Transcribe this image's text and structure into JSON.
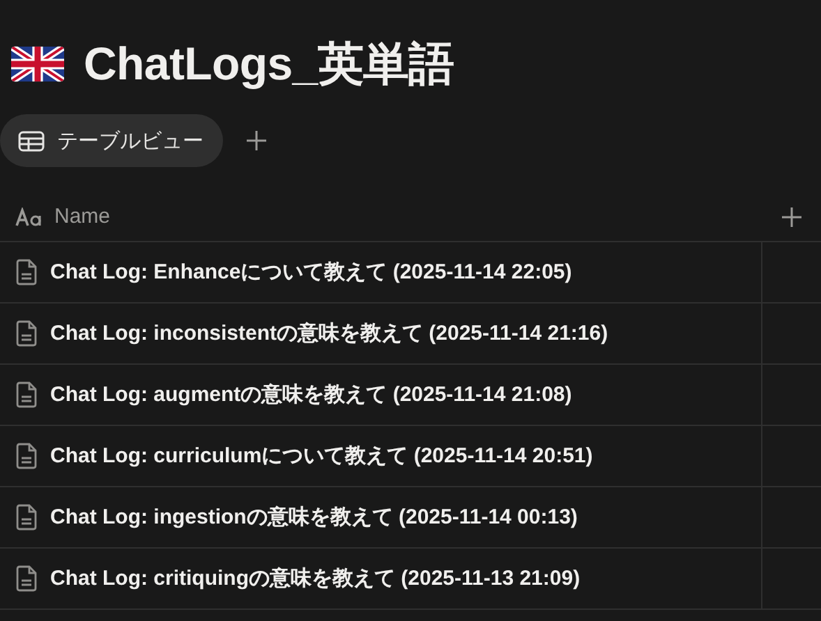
{
  "page": {
    "title": "ChatLogs_英単語"
  },
  "views": [
    {
      "label": "テーブルビュー",
      "selected": true
    }
  ],
  "table": {
    "columns": [
      {
        "label": "Name"
      }
    ],
    "rows": [
      {
        "name": "Chat Log: Enhanceについて教えて (2025-11-14 22:05)"
      },
      {
        "name": "Chat Log: inconsistentの意味を教えて (2025-11-14 21:16)"
      },
      {
        "name": "Chat Log: augmentの意味を教えて (2025-11-14 21:08)"
      },
      {
        "name": "Chat Log: curriculumについて教えて (2025-11-14 20:51)"
      },
      {
        "name": "Chat Log: ingestionの意味を教えて (2025-11-14 00:13)"
      },
      {
        "name": "Chat Log: critiquingの意味を教えて (2025-11-13 21:09)"
      }
    ]
  }
}
